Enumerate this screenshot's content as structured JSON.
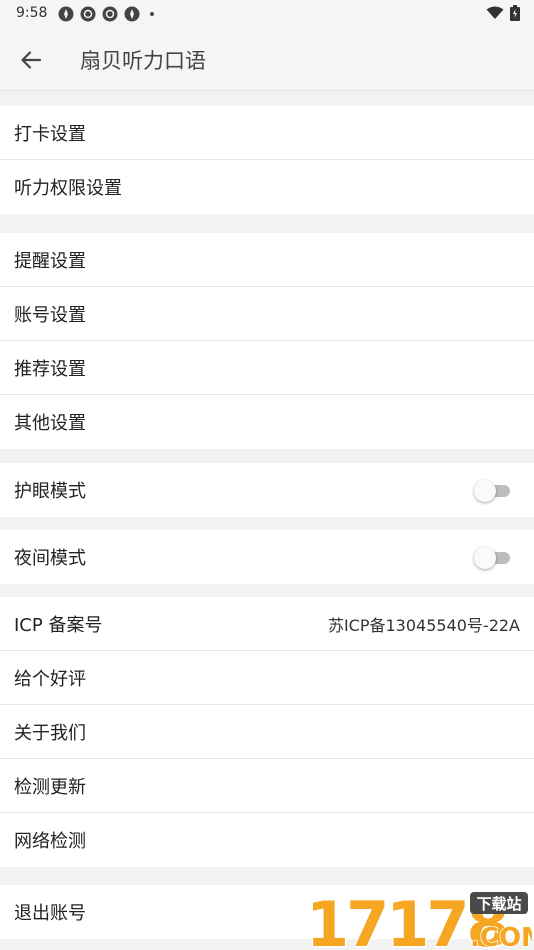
{
  "status_bar": {
    "time": "9:58",
    "icons": [
      "notification-icon",
      "notification-icon",
      "notification-icon",
      "notification-icon"
    ],
    "wifi_icon": "wifi-icon",
    "battery_icon": "battery-icon"
  },
  "app_bar": {
    "back_icon": "arrow-left-icon",
    "title": "扇贝听力口语"
  },
  "groups": {
    "g1": [
      "打卡设置",
      "听力权限设置"
    ],
    "g2": [
      "提醒设置",
      "账号设置",
      "推荐设置",
      "其他设置"
    ],
    "eye_mode": {
      "label": "护眼模式",
      "enabled": false
    },
    "night_mode": {
      "label": "夜间模式",
      "enabled": false
    },
    "g5": {
      "icp_label": "ICP 备案号",
      "icp_value": "苏ICP备13045540号-22A",
      "items": [
        "给个好评",
        "关于我们",
        "检测更新",
        "网络检测"
      ]
    },
    "logout": "退出账号"
  },
  "watermark": {
    "text": "17178",
    "badge": "下载站",
    "domain": ".COM"
  },
  "colors": {
    "background": "#f2f2f2",
    "card": "#ffffff",
    "toggle_off_track": "#bdbdbd",
    "watermark_orange": "#f5a623"
  }
}
